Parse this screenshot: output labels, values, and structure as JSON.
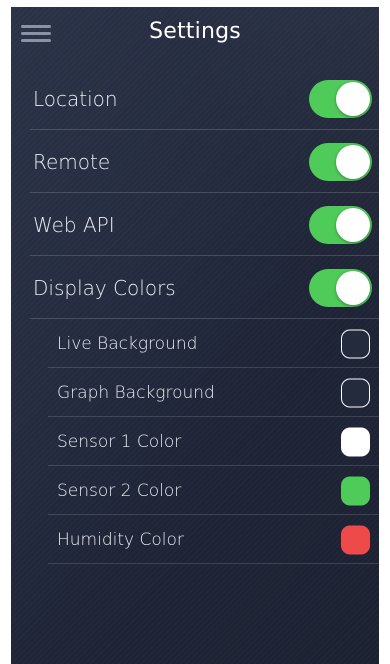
{
  "header": {
    "title": "Settings",
    "menu_icon": "hamburger-menu-icon"
  },
  "toggles": [
    {
      "label": "Location",
      "on": true
    },
    {
      "label": "Remote",
      "on": true
    },
    {
      "label": "Web API",
      "on": true
    },
    {
      "label": "Display Colors",
      "on": true
    }
  ],
  "colors": [
    {
      "label": "Live Background",
      "color": "#242b3d",
      "filled": false
    },
    {
      "label": "Graph Background",
      "color": "#242b3d",
      "filled": false
    },
    {
      "label": "Sensor 1 Color",
      "color": "#ffffff",
      "filled": true
    },
    {
      "label": "Sensor 2 Color",
      "color": "#4fcb59",
      "filled": true
    },
    {
      "label": "Humidity Color",
      "color": "#ee4a4a",
      "filled": true
    }
  ],
  "theme": {
    "toggle_on": "#4fcb59",
    "background": "#252c40"
  }
}
